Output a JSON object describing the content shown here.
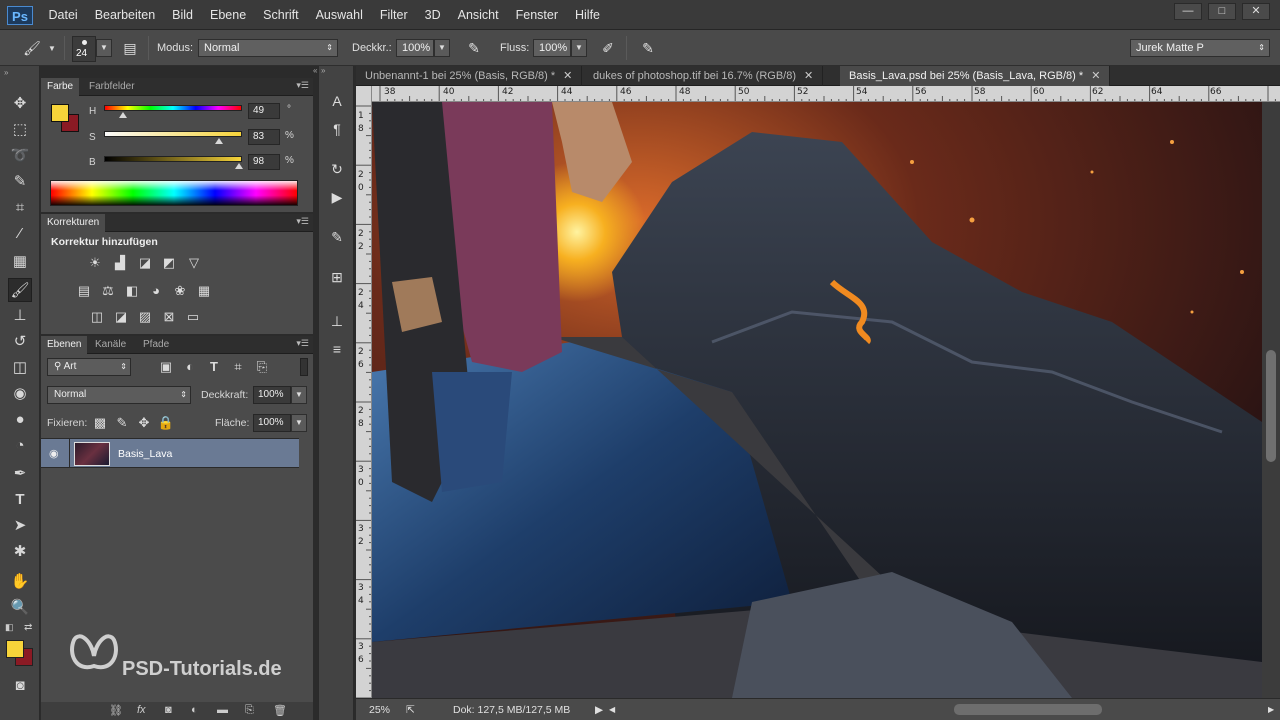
{
  "app": {
    "logo": "Ps",
    "menu": [
      "Datei",
      "Bearbeiten",
      "Bild",
      "Ebene",
      "Schrift",
      "Auswahl",
      "Filter",
      "3D",
      "Ansicht",
      "Fenster",
      "Hilfe"
    ],
    "window_controls": [
      "—",
      "□",
      "✕"
    ]
  },
  "options_bar": {
    "brush_size": "24",
    "modus_label": "Modus:",
    "modus_value": "Normal",
    "deckkraft_label": "Deckkr.:",
    "deckkraft_value": "100%",
    "fluss_label": "Fluss:",
    "fluss_value": "100%",
    "workspace": "Jurek Matte P"
  },
  "color_panel": {
    "tabs": [
      "Farbe",
      "Farbfelder"
    ],
    "h_label": "H",
    "h_value": "49",
    "h_unit": "°",
    "h_fraction": 0.136,
    "s_label": "S",
    "s_value": "83",
    "s_unit": "%",
    "s_fraction": 0.83,
    "b_label": "B",
    "b_value": "98",
    "b_unit": "%",
    "b_fraction": 0.98,
    "foreground": "#f7d43a",
    "background": "#8b1a24"
  },
  "adjustments_panel": {
    "tab": "Korrekturen",
    "heading": "Korrektur hinzufügen"
  },
  "layers_panel": {
    "tabs": [
      "Ebenen",
      "Kanäle",
      "Pfade"
    ],
    "filter_kind": "Art",
    "blend_mode": "Normal",
    "opacity_label": "Deckkraft:",
    "opacity_value": "100%",
    "lock_label": "Fixieren:",
    "fill_label": "Fläche:",
    "fill_value": "100%",
    "layers": [
      {
        "name": "Basis_Lava",
        "visible": true,
        "selected": true
      }
    ]
  },
  "documents": {
    "tabs": [
      {
        "label": "Unbenannt-1 bei 25% (Basis, RGB/8) *",
        "active": false
      },
      {
        "label": "dukes of photoshop.tif bei 16.7% (RGB/8)",
        "active": false
      },
      {
        "label": "Basis_Lava.psd bei 25% (Basis_Lava, RGB/8) *",
        "active": true
      }
    ],
    "ruler_top": [
      "38",
      "40",
      "42",
      "44",
      "46",
      "48",
      "50",
      "52",
      "54",
      "56",
      "58",
      "60",
      "62",
      "64",
      "66"
    ],
    "ruler_left": [
      "1 8",
      "2 0",
      "2 2",
      "2 4",
      "2 6",
      "2 8",
      "3 0",
      "3 2",
      "3 4",
      "3 6"
    ]
  },
  "status_bar": {
    "zoom": "25%",
    "doc_info": "Dok: 127,5 MB/127,5 MB"
  },
  "watermark": {
    "text": "PSD-Tutorials.de"
  }
}
